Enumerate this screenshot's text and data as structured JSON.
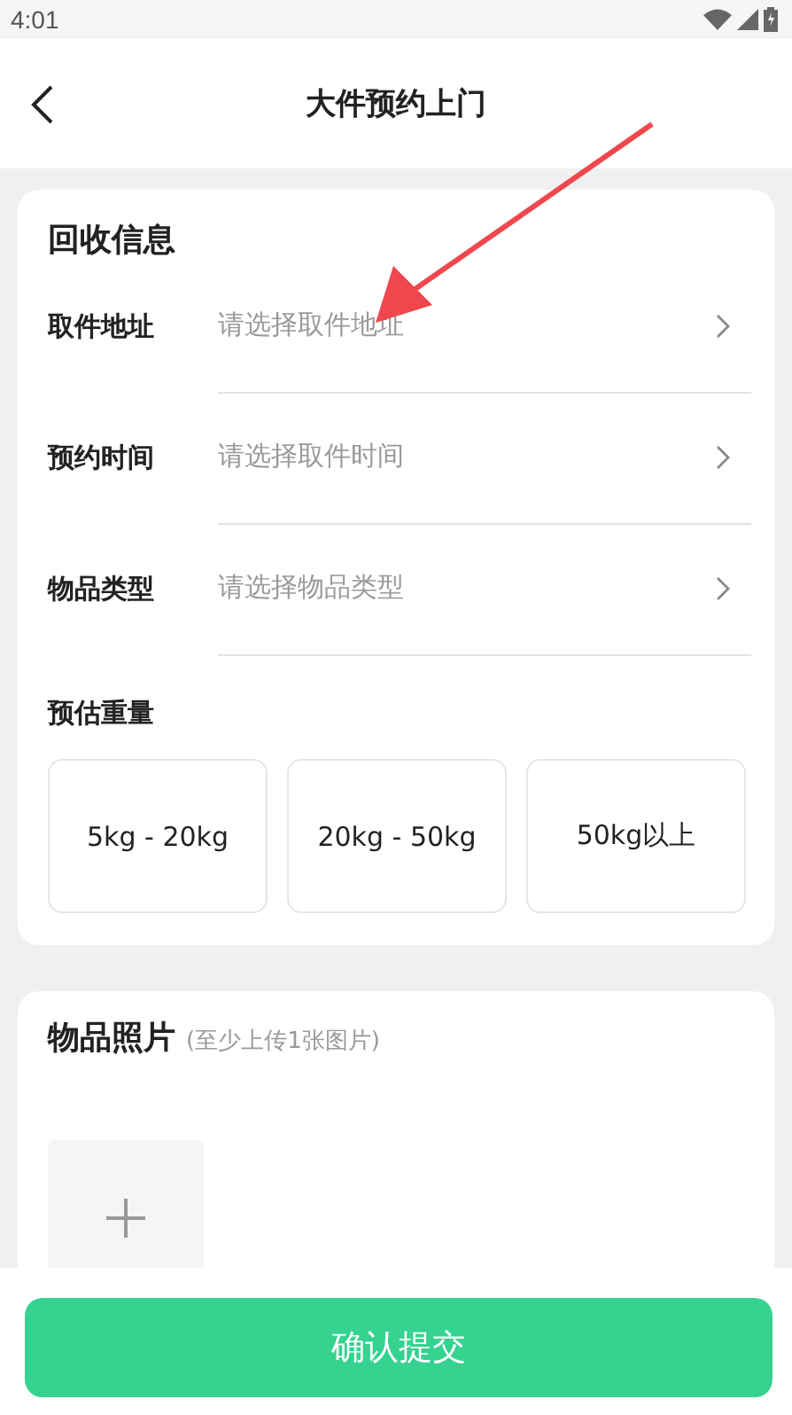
{
  "status_bar": {
    "time": "4:01"
  },
  "header": {
    "title": "大件预约上门"
  },
  "recycle_info": {
    "title": "回收信息",
    "rows": [
      {
        "label": "取件地址",
        "placeholder": "请选择取件地址"
      },
      {
        "label": "预约时间",
        "placeholder": "请选择取件时间"
      },
      {
        "label": "物品类型",
        "placeholder": "请选择物品类型"
      }
    ],
    "weight": {
      "label": "预估重量",
      "options": [
        {
          "label": "5kg - 20kg",
          "selected": false
        },
        {
          "label": "20kg - 50kg",
          "selected": false
        },
        {
          "label": "50kg以上",
          "selected": false
        }
      ]
    }
  },
  "photos": {
    "title": "物品照片",
    "hint": "(至少上传1张图片)"
  },
  "submit": {
    "label": "确认提交"
  }
}
